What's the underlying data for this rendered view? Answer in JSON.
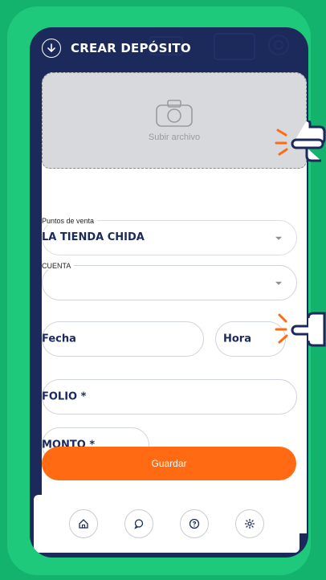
{
  "header": {
    "title": "CREAR DEPÓSITO"
  },
  "upload": {
    "label": "Subir archivo",
    "icon": "camera-icon"
  },
  "fields": {
    "puntos_label": "Puntos de venta",
    "puntos_value": "LA TIENDA CHIDA",
    "cuenta_label": "CUENTA",
    "cuenta_value": "",
    "fecha": "Fecha",
    "hora": "Hora",
    "folio": "FOLIO *",
    "monto": "MONTO *"
  },
  "actions": {
    "save_label": "Guardar"
  },
  "nav": [
    "home-icon",
    "chat-icon",
    "help-icon",
    "settings-icon"
  ],
  "colors": {
    "background": "#13b36e",
    "frame": "#1fc97b",
    "header": "#1b2a5a",
    "accent": "#ff6a13",
    "text": "#1b2a5a"
  }
}
